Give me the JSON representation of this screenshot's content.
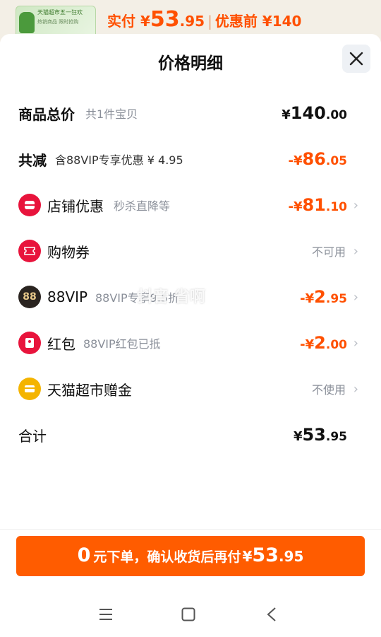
{
  "background": {
    "thumb_label": "天猫超市五一狂欢",
    "thumb_sub": "热销商品 限时抢购",
    "price_prefix": "实付 ¥",
    "price_int": "53",
    "price_dec": ".95",
    "original_price": "优惠前 ¥140"
  },
  "sheet": {
    "title": "价格明细"
  },
  "rows": [
    {
      "id": "total",
      "title": "商品总价",
      "sub": "共1件宝贝",
      "yen": "¥",
      "int": "140",
      "dec": ".00",
      "color": "black"
    },
    {
      "id": "reduce",
      "title": "共减",
      "sub": "含88VIP专享优惠 ¥ 4.95",
      "yen": "-¥",
      "int": "86",
      "dec": ".05",
      "color": "orange"
    },
    {
      "id": "shop",
      "title": "店铺优惠",
      "sub": "秒杀直降等",
      "yen": "-¥",
      "int": "81",
      "dec": ".10",
      "color": "orange",
      "icon": "shop-icon"
    },
    {
      "id": "coupon",
      "title": "购物券",
      "status": "不可用",
      "icon": "coupon-icon"
    },
    {
      "id": "vip",
      "title": "88VIP",
      "sub": "88VIP专享9.5折",
      "yen": "-¥",
      "int": "2",
      "dec": ".95",
      "color": "orange",
      "icon": "vip-icon",
      "icon_text": "88"
    },
    {
      "id": "redpacket",
      "title": "红包",
      "sub": "88VIP红包已抵",
      "yen": "-¥",
      "int": "2",
      "dec": ".00",
      "color": "orange",
      "icon": "red-packet-icon"
    },
    {
      "id": "gift",
      "title": "天猫超市赠金",
      "status": "不使用",
      "icon": "gift-card-icon"
    },
    {
      "id": "sum",
      "title": "合计",
      "yen": "¥",
      "int": "53",
      "dec": ".95",
      "color": "black"
    }
  ],
  "watermark": "抖音 省啊",
  "pay_button": {
    "zero": "0",
    "text": "元下单，确认收货后再付",
    "yen": "¥",
    "int": "53",
    "dec": ".95"
  },
  "colors": {
    "accent": "#ff5000",
    "button": "#ff5c00",
    "shop_icon": "#e8143c",
    "coupon_icon": "#e8143c",
    "vip_icon": "#2a2420",
    "red_packet_icon": "#e8143c",
    "gift_icon": "#f4b400"
  }
}
